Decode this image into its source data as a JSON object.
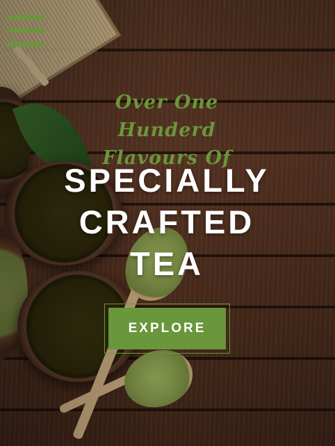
{
  "menu": {
    "icon": "hamburger-menu-icon"
  },
  "hero": {
    "tagline_line1": "Over One Hunderd",
    "tagline_line2": "Flavours Of",
    "headline_line1": "SPECIALLY",
    "headline_line2": "CRAFTED",
    "headline_line3": "TEA",
    "cta_label": "EXPLORE"
  },
  "colors": {
    "accent": "#6a963c",
    "headline": "#ffffff",
    "background": "#4a2d1d"
  }
}
